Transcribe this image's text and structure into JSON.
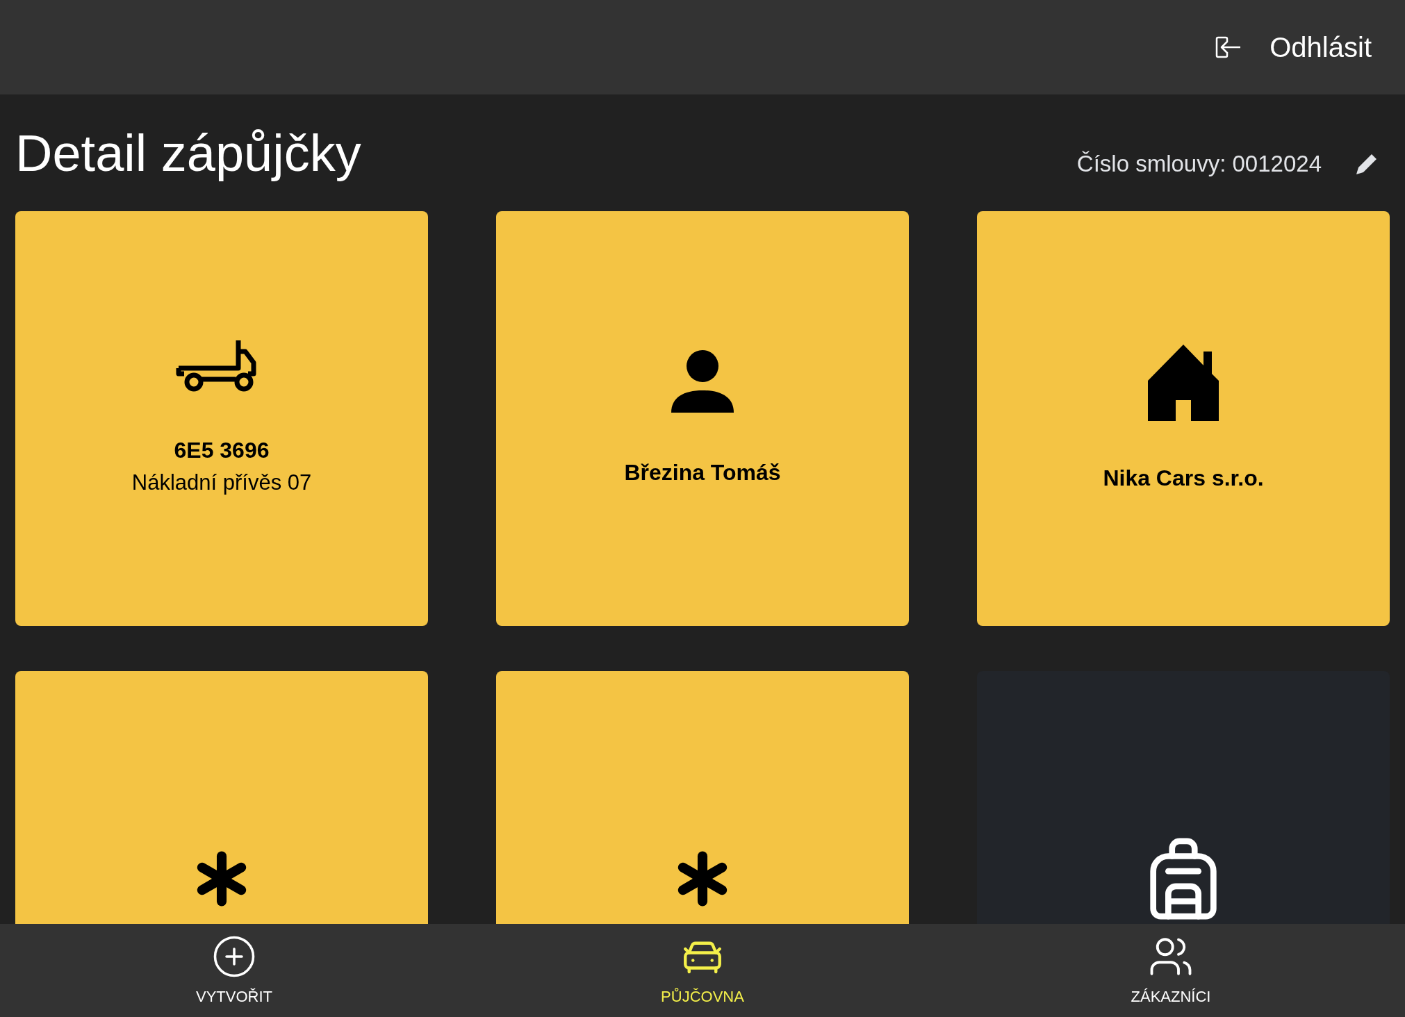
{
  "top_bar": {
    "logout_label": "Odhlásit"
  },
  "page": {
    "title": "Detail zápůjčky",
    "contract_label": "Číslo smlouvy: 0012024"
  },
  "cards": [
    {
      "kind": "trailer",
      "title": "6E5 3696",
      "subtitle": "Nákladní přívěs 07"
    },
    {
      "kind": "person",
      "title": "Březina Tomáš"
    },
    {
      "kind": "house",
      "title": "Nika Cars s.r.o."
    },
    {
      "kind": "asterisk"
    },
    {
      "kind": "asterisk"
    },
    {
      "kind": "backpack"
    }
  ],
  "bottom_nav": [
    {
      "kind": "create",
      "label": "VYTVOŘIT",
      "selected": false
    },
    {
      "kind": "car",
      "label": "PŮJČOVNA",
      "selected": true
    },
    {
      "kind": "customers",
      "label": "ZÁKAZNÍCI",
      "selected": false
    }
  ]
}
